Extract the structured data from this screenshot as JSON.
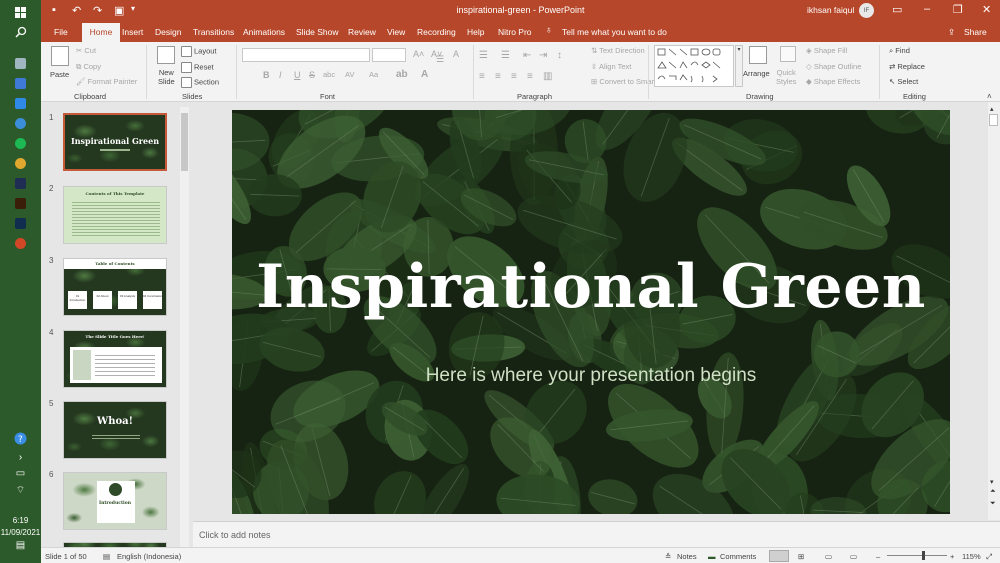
{
  "window": {
    "title": "inspirational-green  -  PowerPoint",
    "user_name": "ikhsan faiqul",
    "user_initials": "IF",
    "share_label": "Share"
  },
  "tabs": [
    "File",
    "Home",
    "Insert",
    "Design",
    "Transitions",
    "Animations",
    "Slide Show",
    "Review",
    "View",
    "Recording",
    "Help",
    "Nitro Pro"
  ],
  "tell_me": "Tell me what you want to do",
  "ribbon": {
    "clipboard": {
      "paste": "Paste",
      "cut": "Cut",
      "copy": "Copy",
      "format_painter": "Format Painter",
      "label": "Clipboard"
    },
    "slides": {
      "new_slide_1": "New",
      "new_slide_2": "Slide",
      "layout": "Layout",
      "reset": "Reset",
      "section": "Section",
      "label": "Slides"
    },
    "font": {
      "label": "Font",
      "bold": "B",
      "italic": "I",
      "underline": "U",
      "strike": "S",
      "shadow": "abc",
      "spacing": "AV",
      "case": "Aa"
    },
    "paragraph": {
      "text_direction": "Text Direction",
      "align_text": "Align Text",
      "smartart": "Convert to SmartArt",
      "label": "Paragraph"
    },
    "drawing": {
      "arrange": "Arrange",
      "quick_styles_1": "Quick",
      "quick_styles_2": "Styles",
      "shape_fill": "Shape Fill",
      "shape_outline": "Shape Outline",
      "shape_effects": "Shape Effects",
      "label": "Drawing"
    },
    "editing": {
      "find": "Find",
      "replace": "Replace",
      "select": "Select",
      "label": "Editing"
    }
  },
  "thumbnails": [
    {
      "num": "1",
      "title": "Inspirational Green"
    },
    {
      "num": "2",
      "title": "Contents of This Template"
    },
    {
      "num": "3",
      "title": "Table of Contents",
      "items": [
        "01 Introduction",
        "02 About",
        "03 Analysis",
        "04 Conclusion"
      ]
    },
    {
      "num": "4",
      "title": "The Slide Title Goes Here!"
    },
    {
      "num": "5",
      "title": "Whoa!"
    },
    {
      "num": "6",
      "title": "Introduction"
    }
  ],
  "slide": {
    "title": "Inspirational Green",
    "subtitle": "Here is where your presentation begins"
  },
  "notes_placeholder": "Click to add notes",
  "status": {
    "slide_count": "Slide 1 of 50",
    "language": "English (Indonesia)",
    "notes": "Notes",
    "comments": "Comments",
    "zoom": "115%",
    "zoom_level": 0.6
  },
  "taskbar": {
    "time": "6:19",
    "date": "11/09/2021"
  },
  "colors": {
    "accent": "#b7472a",
    "taskbar": "#2c5a2a"
  }
}
